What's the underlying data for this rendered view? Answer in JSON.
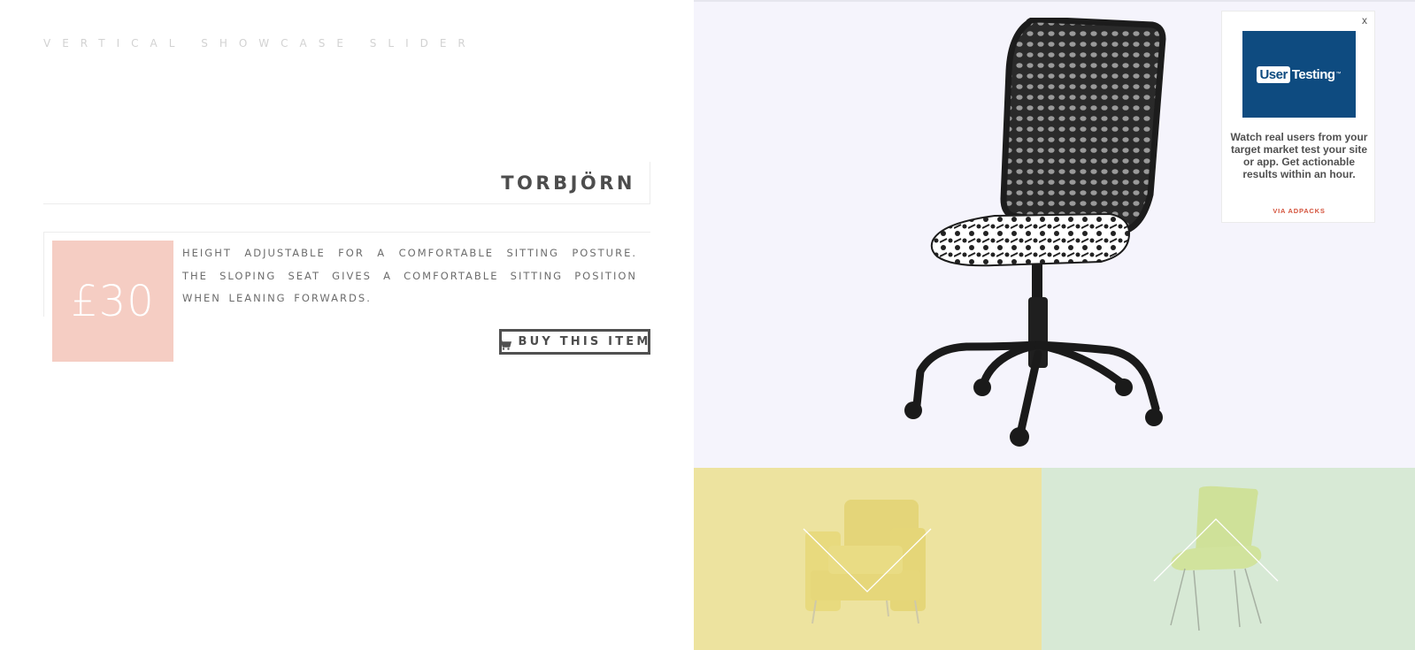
{
  "page": {
    "title": "Vertical Showcase Slider"
  },
  "product": {
    "name": "TORBJÖRN",
    "price": "£30",
    "price_color": "#f5cdc3",
    "description": "Height adjustable for a comfortable sitting posture. The sloping seat gives a comfortable sitting position when leaning forwards.",
    "buy_label": "BUY THIS ITEM",
    "buy_icon": "cart-icon"
  },
  "slides": {
    "hero_background": "#f5f4fc",
    "prev_tile_color": "#ede39f",
    "next_tile_color": "#d7e9d5",
    "prev_icon": "chevron-down-icon",
    "next_icon": "chevron-up-icon"
  },
  "ad": {
    "close": "x",
    "logo_user": "User",
    "logo_testing": "Testing",
    "logo_tm": "™",
    "text": "Watch real users from your target market test your site or app. Get actionable results within an hour.",
    "via": "VIA ADPACKS",
    "logo_color": "#0e4b80"
  }
}
